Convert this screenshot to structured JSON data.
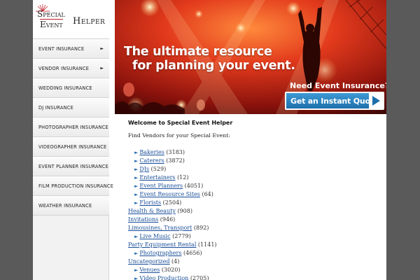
{
  "logo": {
    "line1": "Special",
    "line2": "Event",
    "line3": "Helper"
  },
  "nav": {
    "items": [
      {
        "label": "EVENT INSURANCE",
        "has_submenu": true
      },
      {
        "label": "VENDOR INSURANCE",
        "has_submenu": true
      },
      {
        "label": "WEDDING INSURANCE",
        "has_submenu": false
      },
      {
        "label": "DJ INSURANCE",
        "has_submenu": false
      },
      {
        "label": "PHOTOGRAPHER INSURANCE",
        "has_submenu": false
      },
      {
        "label": "VIDEOGRAPHER INSURANCE",
        "has_submenu": false
      },
      {
        "label": "EVENT PLANNER INSURANCE",
        "has_submenu": false
      },
      {
        "label": "FILM PRODUCTION INSURANCE",
        "has_submenu": false
      },
      {
        "label": "WEATHER INSURANCE",
        "has_submenu": false
      }
    ],
    "caret": "►"
  },
  "hero": {
    "headline_1": "The ultimate resource",
    "headline_2": "for planning your event.",
    "need_insurance": "Need Event Insurance?",
    "quote_button": "Get an Instant Quote"
  },
  "content": {
    "welcome": "Welcome to Special Event Helper",
    "intro": "Find Vendors for your Special Event:",
    "bullet": "►",
    "vendors": [
      {
        "name": "Bakeries",
        "count": "(3183)",
        "bullet": true
      },
      {
        "name": "Caterers",
        "count": "(3872)",
        "bullet": true
      },
      {
        "name": "DJs",
        "count": "(529)",
        "bullet": true
      },
      {
        "name": "Entertainers",
        "count": "(12)",
        "bullet": true
      },
      {
        "name": "Event Planners",
        "count": "(4051)",
        "bullet": true
      },
      {
        "name": "Event Resource Sites",
        "count": "(64)",
        "bullet": true
      },
      {
        "name": "Florists",
        "count": "(2504)",
        "bullet": true
      },
      {
        "name": "Health & Beauty",
        "count": "(908)",
        "bullet": false
      },
      {
        "name": "Invitations",
        "count": "(946)",
        "bullet": false
      },
      {
        "name": "Limousines, Transport",
        "count": "(892)",
        "bullet": false
      },
      {
        "name": "Live Music",
        "count": "(2779)",
        "bullet": true
      },
      {
        "name": "Party Equipment Rental",
        "count": "(1141)",
        "bullet": false
      },
      {
        "name": "Photographers",
        "count": "(4656)",
        "bullet": true
      },
      {
        "name": "Uncategorized",
        "count": "(4)",
        "bullet": false
      },
      {
        "name": "Venues",
        "count": "(3020)",
        "bullet": true
      },
      {
        "name": "Video Production",
        "count": "(2705)",
        "bullet": true
      }
    ]
  },
  "colors": {
    "background": "#5a5a5a",
    "link": "#1a4f99",
    "quote_button": "#2a82c2",
    "logo_accent": "#c0202a"
  },
  "icons": {
    "quote_arrow": "play-arrow-icon"
  }
}
